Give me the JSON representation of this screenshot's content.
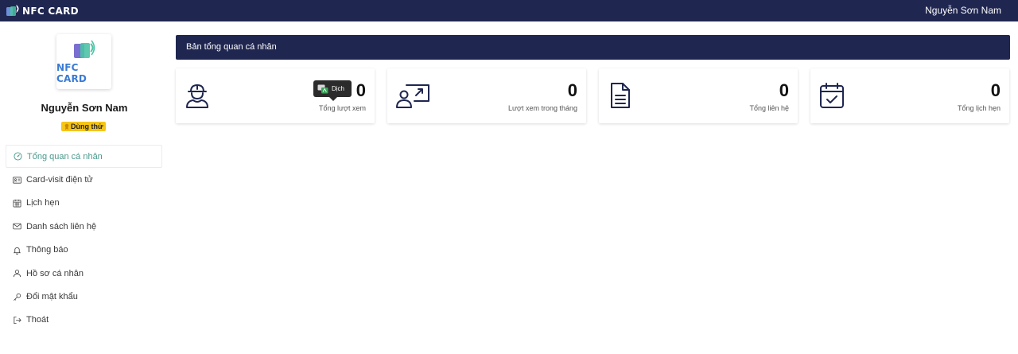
{
  "app": {
    "logo_text": "NFC CARD",
    "user_name": "Nguyễn Sơn Nam",
    "brand_color": "#1f2650",
    "accent_color": "#4a9b8e"
  },
  "profile": {
    "logo_text": "NFC CARD",
    "name": "Nguyễn Sơn Nam",
    "badge": "Dùng thử",
    "badge_color": "#f5c518"
  },
  "menu": [
    {
      "label": "Tổng quan cá nhân",
      "icon": "dashboard-gauge-icon",
      "active": true
    },
    {
      "label": "Card-visit điện tử",
      "icon": "id-card-icon",
      "active": false
    },
    {
      "label": "Lịch hẹn",
      "icon": "calendar-icon",
      "active": false
    },
    {
      "label": "Danh sách liên hệ",
      "icon": "envelope-icon",
      "active": false
    },
    {
      "label": "Thông báo",
      "icon": "bell-icon",
      "active": false
    },
    {
      "label": "Hồ sơ cá nhân",
      "icon": "user-icon",
      "active": false
    },
    {
      "label": "Đổi mật khẩu",
      "icon": "key-icon",
      "active": false
    },
    {
      "label": "Thoát",
      "icon": "logout-icon",
      "active": false
    }
  ],
  "main": {
    "title": "Bản tổng quan cá nhân",
    "cards": [
      {
        "value": "0",
        "label": "Tổng lượt xem",
        "icon": "user-hardhat-icon"
      },
      {
        "value": "0",
        "label": "Lượt xem trong tháng",
        "icon": "presentation-user-icon"
      },
      {
        "value": "0",
        "label": "Tổng liên hệ",
        "icon": "document-icon"
      },
      {
        "value": "0",
        "label": "Tổng lịch hẹn",
        "icon": "calendar-check-icon"
      }
    ]
  },
  "tooltip": {
    "label": "Dịch"
  }
}
